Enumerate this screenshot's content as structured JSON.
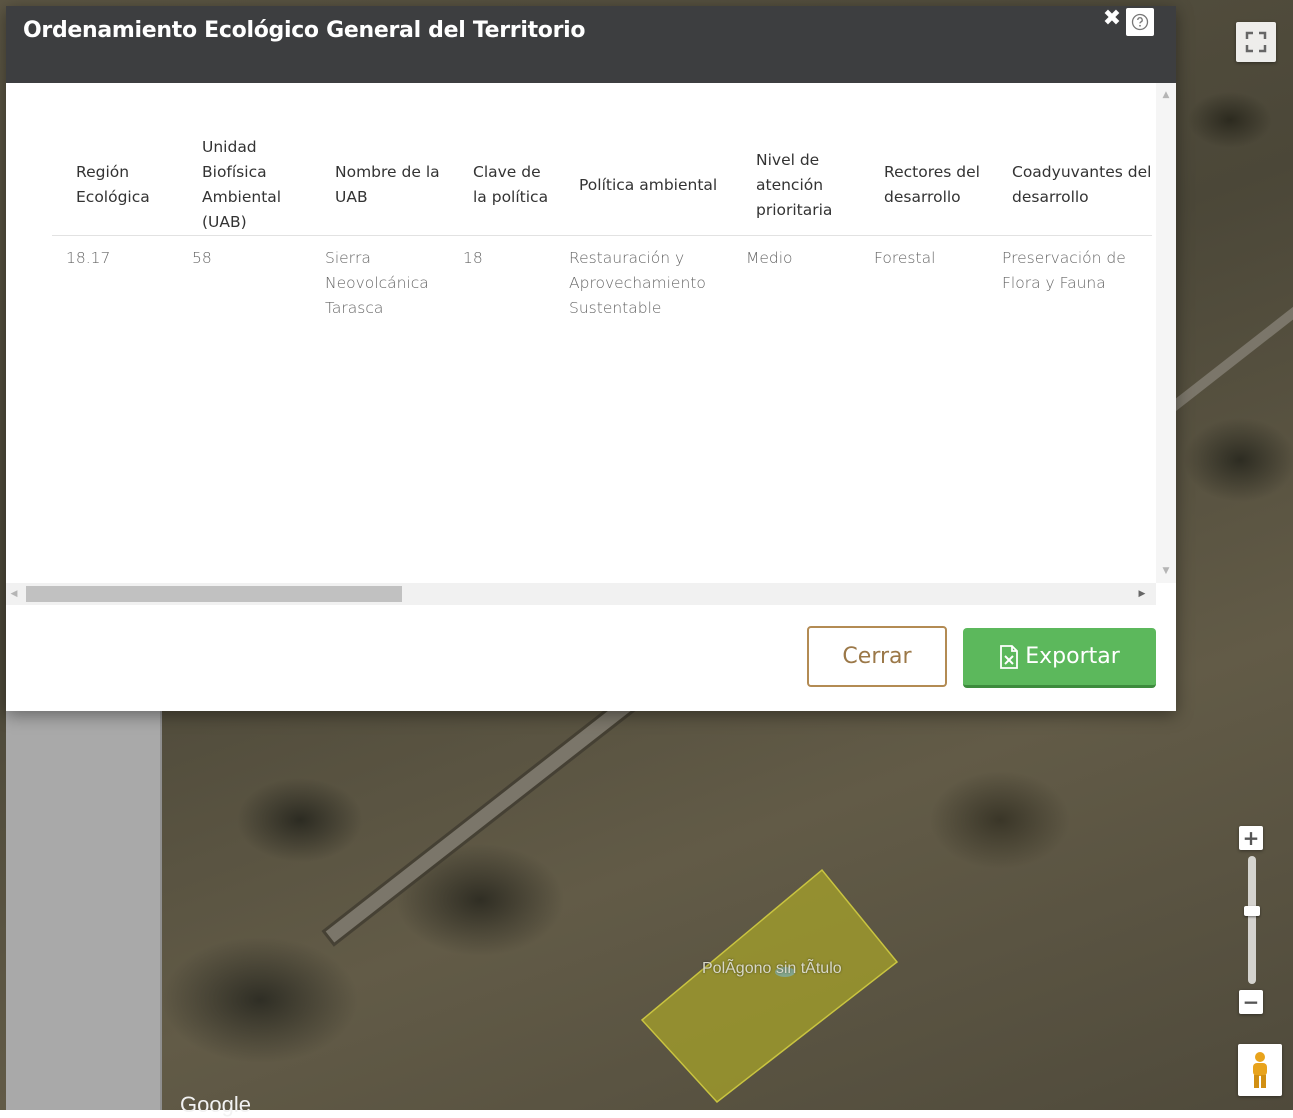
{
  "dialog": {
    "title": "Ordenamiento Ecológico General del Territorio",
    "close_icon": "close-icon",
    "help_icon": "help-icon"
  },
  "table": {
    "headers": [
      "Región Ecológica",
      "Unidad Biofísica Ambiental (UAB)",
      "Nombre de la UAB",
      "Clave de la política",
      "Política ambiental",
      "Nivel de atención prioritaria",
      "Rectores del desarrollo",
      "Coadyuvantes del desarrollo"
    ],
    "rows": [
      [
        "18.17",
        "58",
        "Sierra Neovolcánica Tarasca",
        "18",
        "Restauración y Aprovechamiento Sustentable",
        "Medio",
        "Forestal",
        "Preservación de Flora y Fauna"
      ]
    ]
  },
  "footer": {
    "cerrar_label": "Cerrar",
    "exportar_label": "Exportar",
    "exportar_icon": "excel-file-icon"
  },
  "map": {
    "polygon_label": "PolÃgono sin tÃtulo",
    "google_mark": "Google",
    "zoom_in": "+",
    "zoom_out": "−"
  },
  "colors": {
    "header_bg": "#3d3e40",
    "export_green": "#5cb85c",
    "cerrar_border": "#b38b53",
    "polygon_fill": "#a5a12a"
  }
}
